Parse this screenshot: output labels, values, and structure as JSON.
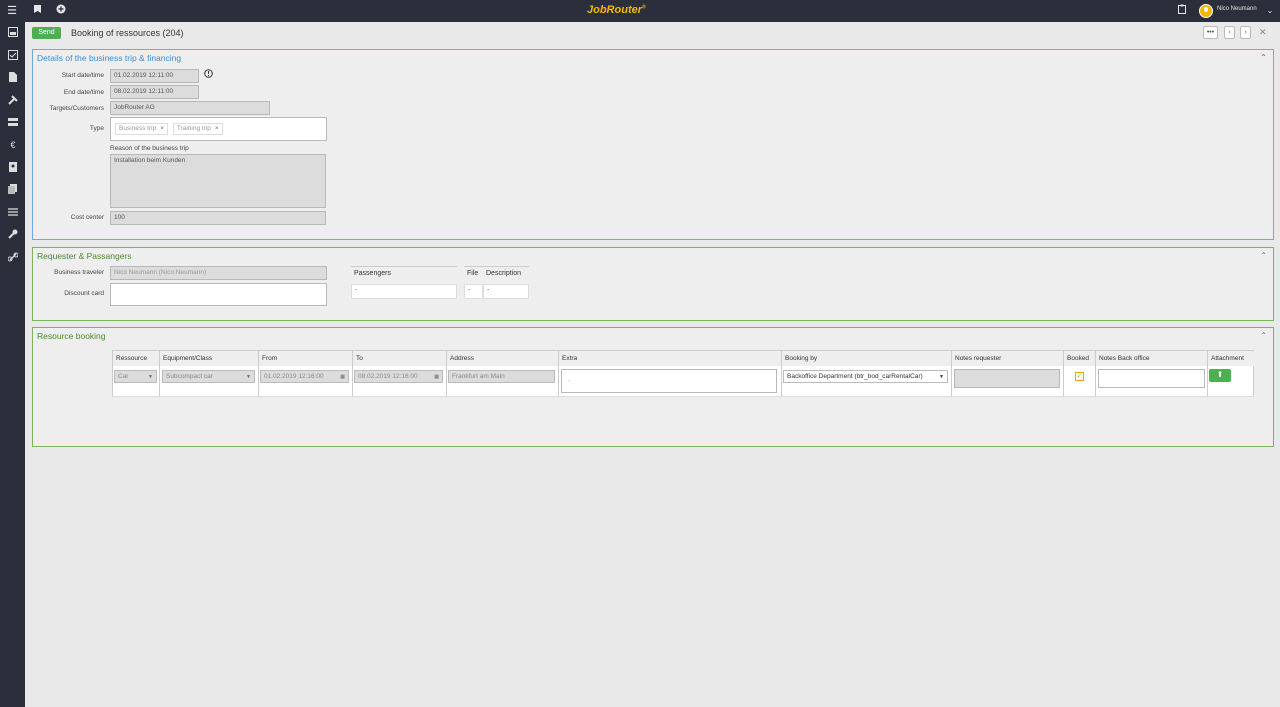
{
  "topbar": {
    "menu_icon": "☰",
    "logo": "JobRouter",
    "logo_mark": "®",
    "user_name": "Nico Neumann"
  },
  "header": {
    "send_label": "Send",
    "title": "Booking of ressources (204)",
    "more_label": "•••",
    "prev_label": "‹",
    "next_label": "›",
    "close_label": "✕"
  },
  "details": {
    "title": "Details of the business trip & financing",
    "start_label": "Start date/time",
    "start_value": "01.02.2019 12:11:00",
    "end_label": "End date/time",
    "end_value": "08.02.2019 12:11:00",
    "targets_label": "Targets/Customers",
    "targets_value": "JobRouter AG",
    "type_label": "Type",
    "type_tags": [
      "Business trip",
      "Training trip"
    ],
    "tag_remove": "×",
    "reason_label": "Reason of the business trip",
    "reason_value": "Installation beim Kunden",
    "cost_label": "Cost center",
    "cost_value": "100"
  },
  "requester": {
    "title": "Requester & Passangers",
    "traveler_label": "Business traveler",
    "traveler_value": "Nico Neumann (Nico.Neumann)",
    "discount_label": "Discount card",
    "passengers_header": "Passengers",
    "passengers_cell": "-",
    "file_header": "File",
    "file_cell": "-",
    "description_header": "Description",
    "description_cell": "-"
  },
  "resource": {
    "title": "Resource booking",
    "columns": [
      "Ressource",
      "Equipment/Class",
      "From",
      "To",
      "Address",
      "Extra",
      "Booking by",
      "Notes requester",
      "Booked",
      "Notes Back office",
      "Attachment"
    ],
    "row": {
      "ressource": "Car",
      "equipment": "Subcompact car",
      "from": "01.02.2019 12:16:00",
      "to": "08.02.2019 12:16:00",
      "address": "Frankfurt am Main",
      "extra": "-",
      "booking_by": "Backoffice Department (btr_bod_carRentalCar)",
      "booked_mark": "✓",
      "attachment_icon": "⬆"
    }
  },
  "colors": {
    "accent_blue": "#3a8dd6",
    "accent_green": "#4a8a2c",
    "send_green": "#4caf50",
    "brand_yellow": "#f5b800",
    "topbar": "#2b2f3b"
  }
}
